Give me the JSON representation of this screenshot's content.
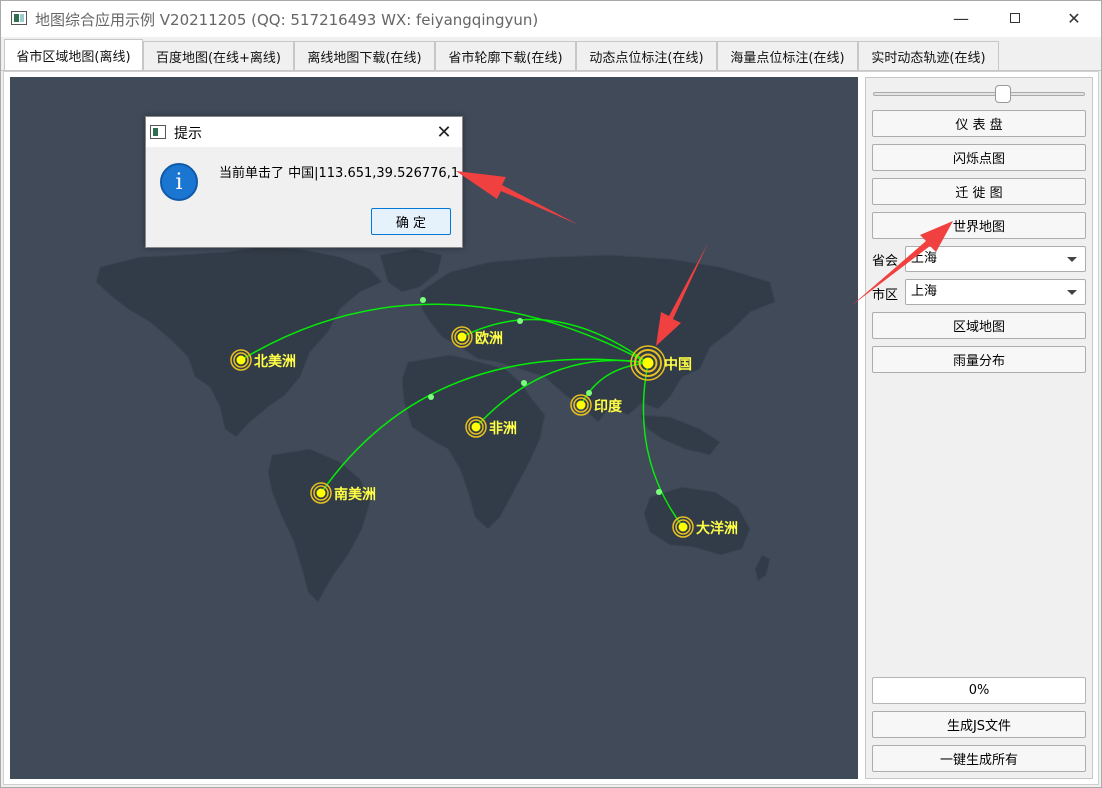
{
  "window": {
    "title": "地图综合应用示例 V20211205 (QQ: 517216493 WX: feiyangqingyun)",
    "minimize_icon": "minimize-icon",
    "maximize_icon": "maximize-icon",
    "close_icon": "close-icon"
  },
  "tabs": [
    {
      "label": "省市区域地图(离线)",
      "active": true
    },
    {
      "label": "百度地图(在线+离线)",
      "active": false
    },
    {
      "label": "离线地图下载(在线)",
      "active": false
    },
    {
      "label": "省市轮廓下载(在线)",
      "active": false
    },
    {
      "label": "动态点位标注(在线)",
      "active": false
    },
    {
      "label": "海量点位标注(在线)",
      "active": false
    },
    {
      "label": "实时动态轨迹(在线)",
      "active": false
    }
  ],
  "map": {
    "background": "#404a59",
    "land_color": "#323c48",
    "line_color": "#00ff00",
    "marker_color": "#ffff00",
    "points": [
      {
        "name": "北美洲"
      },
      {
        "name": "欧洲"
      },
      {
        "name": "中国"
      },
      {
        "name": "印度"
      },
      {
        "name": "非洲"
      },
      {
        "name": "南美洲"
      },
      {
        "name": "大洋洲"
      }
    ]
  },
  "side": {
    "slider_value": 0.62,
    "buttons": {
      "dashboard": "仪 表 盘",
      "flash_points": "闪烁点图",
      "migration": "迁 徙 图",
      "world_map": "世界地图",
      "region_map": "区域地图",
      "rainfall": "雨量分布",
      "generate_js": "生成JS文件",
      "generate_all": "一键生成所有"
    },
    "province_label": "省会",
    "province_value": "上海",
    "city_label": "市区",
    "city_value": "上海",
    "progress_text": "0%"
  },
  "dialog": {
    "title": "提示",
    "message": "当前单击了 中国|113.651,39.526776,1",
    "ok_label": "确 定",
    "icon": "info-icon"
  },
  "annotation_color": "#f04040"
}
